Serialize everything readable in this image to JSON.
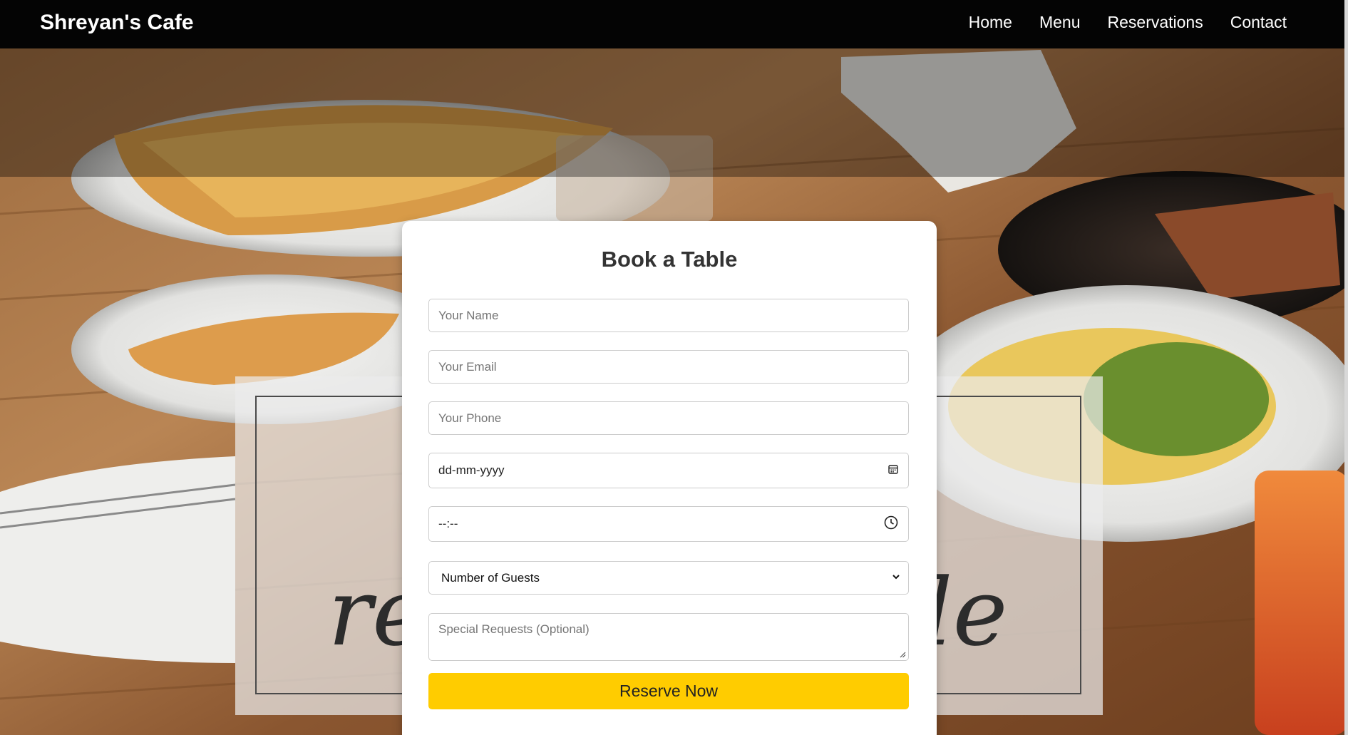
{
  "navbar": {
    "brand": "Shreyan's Cafe",
    "links": [
      {
        "label": "Home"
      },
      {
        "label": "Menu"
      },
      {
        "label": "Reservations"
      },
      {
        "label": "Contact"
      }
    ]
  },
  "background": {
    "sign_text_left": "re",
    "sign_text_right": "le"
  },
  "form": {
    "title": "Book a Table",
    "name_placeholder": "Your Name",
    "email_placeholder": "Your Email",
    "phone_placeholder": "Your Phone",
    "date_value": "dd-mm-yyyy",
    "time_value": "--:--",
    "guests_selected": "Number of Guests",
    "requests_placeholder": "Special Requests (Optional)",
    "submit_label": "Reserve Now"
  },
  "icons": {
    "date": "calendar-icon",
    "time": "clock-icon",
    "select": "chevron-down-icon"
  },
  "colors": {
    "navbar_bg": "#040404",
    "button_bg": "#ffcc00",
    "card_bg": "#ffffff"
  }
}
